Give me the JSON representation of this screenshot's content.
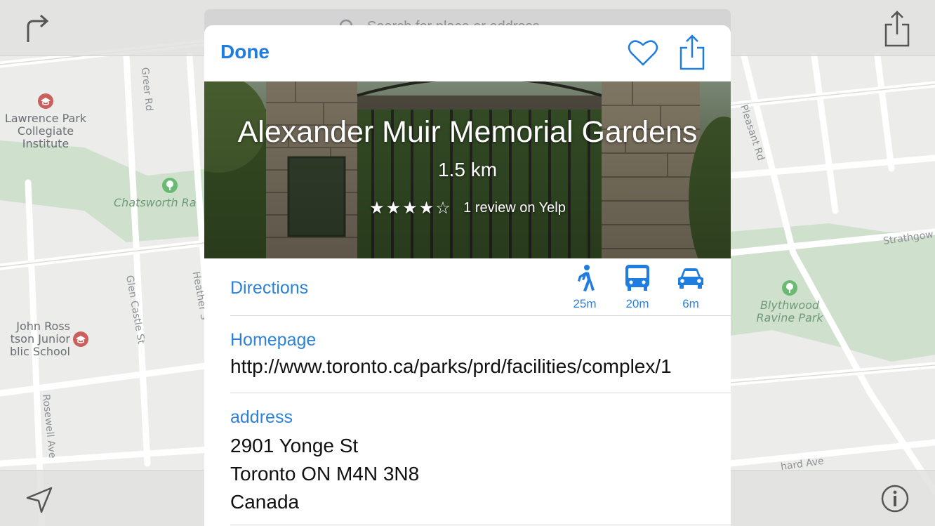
{
  "map": {
    "poi_labels": [
      {
        "id": "lawrence-park",
        "text": "Lawrence Park\nCollegiate\nInstitute"
      },
      {
        "id": "john-ross",
        "text": "John Ross\ntson Junior\nblic School"
      },
      {
        "id": "chatsworth",
        "text": "Chatsworth Ra"
      },
      {
        "id": "blythwood",
        "text": "Blythwood\nRavine Park"
      }
    ],
    "street_labels": [
      {
        "id": "greer",
        "text": "Greer Rd"
      },
      {
        "id": "glen-castle",
        "text": "Glen Castle St"
      },
      {
        "id": "heather",
        "text": "Heather S"
      },
      {
        "id": "rosewell",
        "text": "Rosewell Ave"
      },
      {
        "id": "pleasant",
        "text": "Pleasant Rd"
      },
      {
        "id": "strathgow",
        "text": "Strathgow"
      },
      {
        "id": "blythwood-ave",
        "text": "hard Ave"
      }
    ]
  },
  "search": {
    "placeholder": "Search for place or address"
  },
  "card": {
    "done_label": "Done",
    "title": "Alexander Muir Memorial Gardens",
    "distance": "1.5 km",
    "rating_stars": "★★★★☆",
    "rating": 4,
    "rating_max": 5,
    "rating_text": "1 review on Yelp",
    "directions": {
      "label": "Directions",
      "modes": [
        {
          "icon": "walking-icon",
          "time": "25m"
        },
        {
          "icon": "transit-icon",
          "time": "20m"
        },
        {
          "icon": "car-icon",
          "time": "6m"
        }
      ]
    },
    "homepage": {
      "label": "Homepage",
      "value": "http://www.toronto.ca/parks/prd/facilities/complex/1"
    },
    "address": {
      "label": "address",
      "line1": "2901 Yonge St",
      "line2": "Toronto ON M4N 3N8",
      "line3": "Canada"
    }
  },
  "colors": {
    "accent": "#1f7ce0",
    "link": "#2d82d8",
    "map_park": "#cfe1cf",
    "map_bg": "#ececea"
  }
}
